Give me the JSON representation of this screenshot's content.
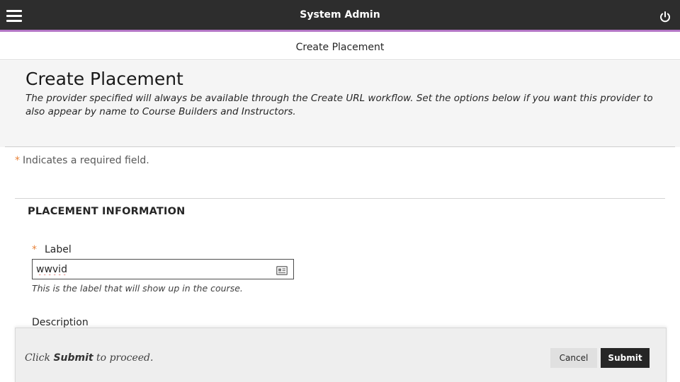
{
  "topbar": {
    "title": "System Admin",
    "menu_icon": "hamburger-menu-icon",
    "power_icon": "power-icon",
    "accent_color": "#b476c6"
  },
  "breadcrumb": {
    "current": "Create Placement"
  },
  "header": {
    "title": "Create Placement",
    "description": "The provider specified will always be available through the Create URL workflow. Set the options below if you want this provider to also appear by name to Course Builders and Instructors."
  },
  "form": {
    "required_marker": "*",
    "required_note": "Indicates a required field.",
    "section_title": "PLACEMENT INFORMATION",
    "label_field": {
      "label": "Label",
      "value": "wwvid",
      "help": "This is the label that will show up in the course.",
      "icon": "contact-card-icon"
    },
    "description_field": {
      "label": "Description"
    }
  },
  "submit_bar": {
    "hint_prefix": "Click ",
    "hint_bold": "Submit",
    "hint_suffix": " to proceed.",
    "cancel_label": "Cancel",
    "submit_label": "Submit"
  }
}
